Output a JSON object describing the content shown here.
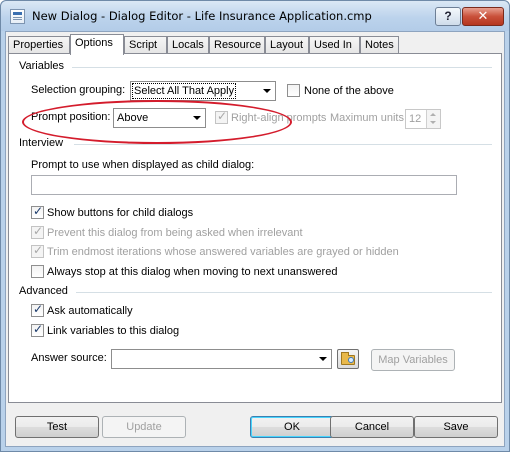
{
  "window": {
    "title": "New Dialog - Dialog Editor - Life Insurance Application.cmp",
    "help_glyph": "?",
    "close_glyph": "✕"
  },
  "tabs": [
    {
      "label": "Properties",
      "active": false
    },
    {
      "label": "Options",
      "active": true
    },
    {
      "label": "Script",
      "active": false
    },
    {
      "label": "Locals",
      "active": false
    },
    {
      "label": "Resource",
      "active": false
    },
    {
      "label": "Layout",
      "active": false
    },
    {
      "label": "Used In",
      "active": false
    },
    {
      "label": "Notes",
      "active": false
    }
  ],
  "variables": {
    "section_label": "Variables",
    "selection_grouping_label": "Selection grouping:",
    "selection_grouping_value": "Select All That Apply",
    "none_of_above_label": "None of the above",
    "none_of_above_checked": false,
    "prompt_position_label": "Prompt position:",
    "prompt_position_value": "Above",
    "right_align_label": "Right-align prompts",
    "right_align_checked": true,
    "maximum_units_label": "Maximum units:",
    "maximum_units_value": "12"
  },
  "interview": {
    "section_label": "Interview",
    "child_prompt_label": "Prompt to use when displayed as child dialog:",
    "child_prompt_value": "",
    "show_buttons_label": "Show buttons for child dialogs",
    "prevent_asked_label": "Prevent this dialog from being asked when irrelevant",
    "trim_iterations_label": "Trim endmost iterations whose answered variables are grayed or hidden",
    "always_stop_label": "Always stop at this dialog when moving to next unanswered"
  },
  "advanced": {
    "section_label": "Advanced",
    "ask_auto_label": "Ask automatically",
    "link_vars_label": "Link variables to this dialog",
    "answer_source_label": "Answer source:",
    "answer_source_value": "",
    "map_variables_label": "Map Variables"
  },
  "footer": {
    "test_label": "Test",
    "update_label": "Update",
    "ok_label": "OK",
    "cancel_label": "Cancel",
    "save_label": "Save"
  },
  "accent": {
    "annotation_ring": "#d41c2c",
    "title_bar": "#b9d1ea",
    "close_button": "#c9503a"
  }
}
